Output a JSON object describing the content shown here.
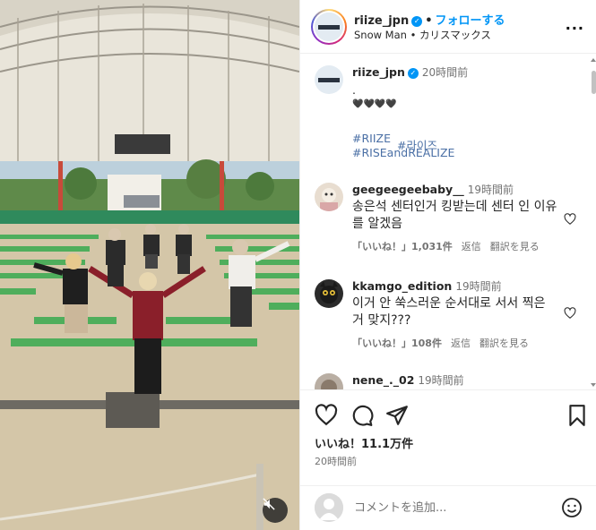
{
  "header": {
    "username": "riize_jpn",
    "separator": "•",
    "follow_label": "フォローする",
    "subtitle": "Snow Man • カリスマックス",
    "more_label": "···"
  },
  "caption": {
    "username": "riize_jpn",
    "time": "20時間前",
    "lines": [
      ".",
      "🖤🖤🖤🖤"
    ],
    "hashtags": [
      "#RIIZE",
      "#라이즈",
      "#RISEandREALIZE"
    ]
  },
  "comments": [
    {
      "username": "geegeegeebaby__",
      "time": "19時間前",
      "text": "송은석 센터인거 킹받는데 센터 인 이유를 알겠음",
      "likes": "「いいね！」1,031件",
      "reply": "返信",
      "translate": "翻訳を見る"
    },
    {
      "username": "kkamgo_edition",
      "time": "19時間前",
      "text": "이거 안 쑥스러운 순서대로 서서 찍은 거 맞지???",
      "likes": "「いいね！」108件",
      "reply": "返信",
      "translate": "翻訳を見る"
    },
    {
      "username": "nene_._02",
      "time": "19時間前"
    }
  ],
  "actions": {
    "likes": "いいね！11.1万件",
    "time": "20時間前"
  },
  "add_comment": {
    "placeholder": "コメントを追加..."
  },
  "colors": {
    "accent": "#0095f6",
    "hashtag": "#4a6fa5",
    "muted": "#737373"
  },
  "icons": [
    "verified-icon",
    "more-icon",
    "heart-icon",
    "comment-icon",
    "share-icon",
    "bookmark-icon",
    "emoji-icon",
    "mute-icon"
  ]
}
